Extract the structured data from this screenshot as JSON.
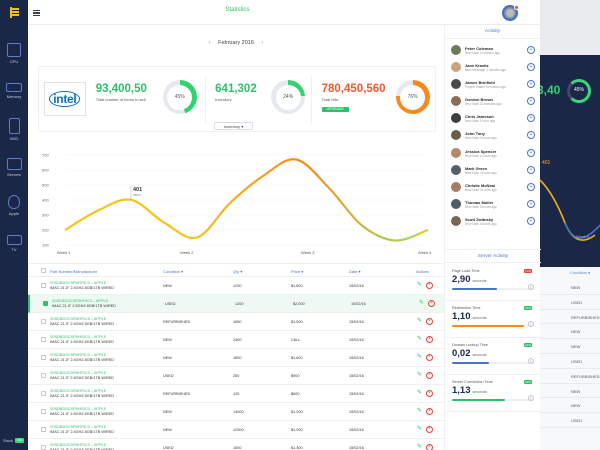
{
  "header": {
    "title": "Statistics"
  },
  "sidebar": {
    "items": [
      {
        "label": "CPU"
      },
      {
        "label": "Memory"
      },
      {
        "label": "HDD"
      },
      {
        "label": "Servers"
      },
      {
        "label": "Apple"
      },
      {
        "label": "TV"
      }
    ],
    "stock_label": "Stock",
    "stock_toggle": "ON"
  },
  "main": {
    "month": "February 2016",
    "brand": "intel",
    "stats": [
      {
        "value": "93,400,50",
        "desc": "Total number of items to sell",
        "color": "#2fbf6a",
        "ring": "45%",
        "ring_frac": 0.45,
        "ring_color": "#2fd46e"
      },
      {
        "value": "641,302",
        "desc": "Inventory",
        "color": "#2fbf6a",
        "ring": "24%",
        "ring_frac": 0.24,
        "ring_color": "#2fd46e"
      },
      {
        "value": "780,450,560",
        "desc": "Total Hits",
        "color": "#ef5a2a",
        "ring": "76%",
        "ring_frac": 0.76,
        "ring_color": "#f7891e",
        "badge": "UPGRADE"
      }
    ],
    "dropdown": "Inventory ▾",
    "chart_data": {
      "type": "line",
      "categories": [
        "Week 1",
        "Week 2",
        "Week 3",
        "Week 4"
      ],
      "y_ticks": [
        "100",
        "200",
        "300",
        "400",
        "500",
        "600",
        "700"
      ],
      "ylim": [
        100,
        700
      ],
      "point_label": "401",
      "point_sublabel": "Items",
      "series": [
        {
          "values": [
            200,
            330,
            401,
            250,
            150,
            380,
            560,
            670,
            480,
            230,
            130,
            200
          ]
        }
      ]
    },
    "table": {
      "headers": [
        "Part Number/Manufacturer",
        "Condition ▾",
        "Qty ▾",
        "Price ▾",
        "Date ▾",
        "Actions"
      ],
      "rows": [
        {
          "p1": "S0SDBDSCSR5HF0C0 – APPLE",
          "p2": "IMAC 21.5\" 2.5GHZ 8GB/1TB WIRED",
          "cond": "NEW",
          "qty": "1200",
          "price": "$1,800",
          "date": "15/02/16",
          "sel": false
        },
        {
          "p1": "S0SDBDSCSR5HF0C0 – APPLE",
          "p2": "IMAC 21.5\" 2.5GHZ 8GB/1TB WIRED",
          "cond": "USED",
          "qty": "1200",
          "price": "$2,000",
          "date": "15/02/16",
          "sel": true
        },
        {
          "p1": "S0SDBDSCSR5HF0C0 – APPLE",
          "p2": "IMAC 21.5\" 2.5GHZ 8GB/1TB WIRED",
          "cond": "REFURBISHED",
          "qty": "1650",
          "price": "$1,500",
          "date": "15/02/16",
          "sel": false
        },
        {
          "p1": "S0SDBDSCSR5HF0C0 – APPLE",
          "p2": "IMAC 21.5\" 2.5GHZ 8GB/1TB WIRED",
          "cond": "NEW",
          "qty": "2400",
          "price": "CALL",
          "date": "15/02/16",
          "sel": false
        },
        {
          "p1": "S0SDBDSCSR5HF0C0 – APPLE",
          "p2": "IMAC 21.5\" 2.5GHZ 8GB/1TB WIRED",
          "cond": "NEW",
          "qty": "1800",
          "price": "$1,600",
          "date": "15/02/16",
          "sel": false
        },
        {
          "p1": "S0SDBDSCSR5HF0C0 – APPLE",
          "p2": "IMAC 21.5\" 2.5GHZ 8GB/1TB WIRED",
          "cond": "USED",
          "qty": "250",
          "price": "$900",
          "date": "15/02/16",
          "sel": false
        },
        {
          "p1": "S0SDBDSCSR5HF0C0 – APPLE",
          "p2": "IMAC 21.5\" 2.5GHZ 8GB/1TB WIRED",
          "cond": "REFURBISHED",
          "qty": "125",
          "price": "$600",
          "date": "15/02/16",
          "sel": false
        },
        {
          "p1": "S0SDBDSCSR5HF0C0 – APPLE",
          "p2": "IMAC 21.5\" 2.5GHZ 8GB/1TB WIRED",
          "cond": "NEW",
          "qty": "14000",
          "price": "$1,200",
          "date": "15/02/16",
          "sel": false
        },
        {
          "p1": "S0SDBDSCSR5HF0C0 – APPLE",
          "p2": "IMAC 21.5\" 2.5GHZ 8GB/1TB WIRED",
          "cond": "NEW",
          "qty": "12000",
          "price": "$1,200",
          "date": "15/02/16",
          "sel": false
        },
        {
          "p1": "S0SDBDSCSR5HF0C0 – APPLE",
          "p2": "IMAC 21.5\" 2.5GHZ 8GB/1TB WIRED",
          "cond": "USED",
          "qty": "1500",
          "price": "$1,300",
          "date": "15/02/16",
          "sel": false
        }
      ]
    }
  },
  "activity": {
    "title": "Activity",
    "items": [
      {
        "name": "Peter Coleman",
        "sub": "New Note 2 minutes ago",
        "color": "#6b7a5a"
      },
      {
        "name": "Jane Kravitz",
        "sub": "New Message 2 minutes ago",
        "color": "#c9a47e"
      },
      {
        "name": "James Brinfield",
        "sub": "Project Status 6 minutes ago",
        "color": "#4a4a4a"
      },
      {
        "name": "Gordon Brown",
        "sub": "New Note 15 minutes ago",
        "color": "#8b6b52"
      },
      {
        "name": "Chris Jameson",
        "sub": "New Note 1 hour ago",
        "color": "#3d3d3d"
      },
      {
        "name": "John Tony",
        "sub": "New Note 2 hours ago",
        "color": "#6d5d4d"
      },
      {
        "name": "Jessica Spencer",
        "sub": "New Note 2 hours ago",
        "color": "#b5896a"
      },
      {
        "name": "Mark Green",
        "sub": "New Note 3 hours ago",
        "color": "#555d66"
      },
      {
        "name": "Christie McNeal",
        "sub": "New Note 4 hours ago",
        "color": "#a37c6b"
      },
      {
        "name": "Thomas Muller",
        "sub": "New Note 5 hours ago",
        "color": "#4e5a64"
      },
      {
        "name": "Scott Zwitnsky",
        "sub": "New Note 6 hours ago",
        "color": "#7a6655"
      }
    ]
  },
  "server": {
    "title": "Server Activity",
    "items": [
      {
        "label": "Page Load Time",
        "value": "2,90",
        "unit": "seconds",
        "pct": "12%",
        "pct_color": "#e4433b",
        "bar_frac": 0.55,
        "bar_color": "#4a74c9"
      },
      {
        "label": "Redirection Time",
        "value": "1,10",
        "unit": "seconds",
        "pct": "12%",
        "pct_color": "#2fbf6a",
        "bar_frac": 0.88,
        "bar_color": "#f7891e"
      },
      {
        "label": "Domain Lookup Time",
        "value": "0,02",
        "unit": "seconds",
        "pct": "12%",
        "pct_color": "#2fbf6a",
        "bar_frac": 0.45,
        "bar_color": "#4a74c9"
      },
      {
        "label": "Server Connection Time",
        "value": "1,13",
        "unit": "seconds",
        "pct": "12%",
        "pct_color": "#2fbf6a",
        "bar_frac": 0.65,
        "bar_color": "#2fbf6a"
      }
    ]
  },
  "ghost": {
    "value": "3,40",
    "ring": "45%",
    "label": "401",
    "week": "Week 4",
    "header": "Condition ▾",
    "conds": [
      "NEW",
      "USED",
      "REFURBISHED",
      "NEW",
      "NEW",
      "USED",
      "REFURBISHED",
      "NEW",
      "NEW",
      "USED"
    ]
  }
}
